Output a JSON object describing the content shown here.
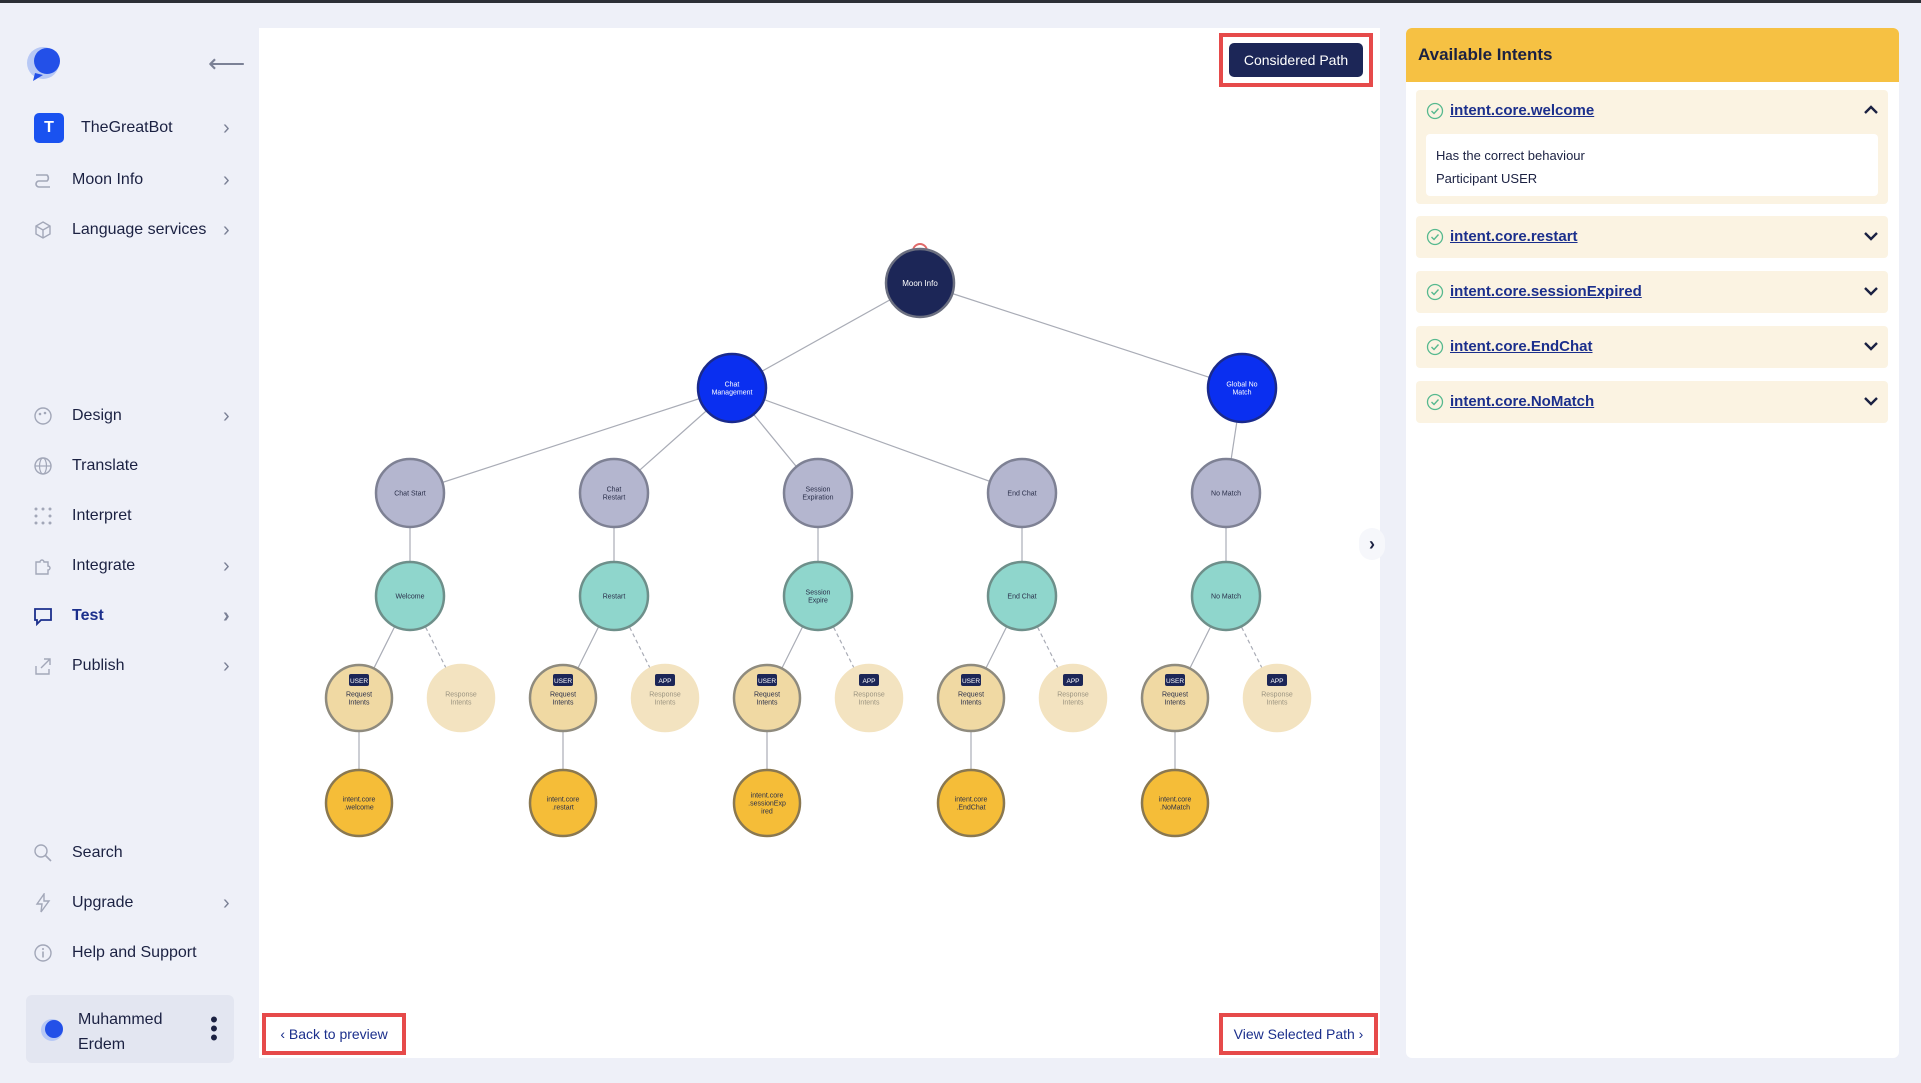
{
  "sidebar": {
    "bot": {
      "initial": "T",
      "name": "TheGreatBot"
    },
    "items_top": [
      {
        "label": "Moon Info",
        "icon": "route-icon",
        "chevron": true
      },
      {
        "label": "Language services",
        "icon": "cube-icon",
        "chevron": true
      }
    ],
    "items_mid": [
      {
        "label": "Design",
        "icon": "palette-icon",
        "chevron": true
      },
      {
        "label": "Translate",
        "icon": "globe-icon",
        "chevron": false
      },
      {
        "label": "Interpret",
        "icon": "dots-grid-icon",
        "chevron": false
      },
      {
        "label": "Integrate",
        "icon": "puzzle-icon",
        "chevron": true
      },
      {
        "label": "Test",
        "icon": "chat-bubble-icon",
        "chevron": true,
        "active": true
      },
      {
        "label": "Publish",
        "icon": "share-icon",
        "chevron": true
      }
    ],
    "items_bottom": [
      {
        "label": "Search",
        "icon": "search-icon",
        "chevron": false
      },
      {
        "label": "Upgrade",
        "icon": "bolt-icon",
        "chevron": true
      },
      {
        "label": "Help and Support",
        "icon": "info-icon",
        "chevron": false
      }
    ],
    "user": {
      "first": "Muhammed",
      "last": "Erdem"
    }
  },
  "canvas": {
    "considered_path_label": "Considered Path",
    "back_label": "‹ Back to preview",
    "view_label": "View Selected Path ›",
    "expand_label": "›"
  },
  "tree": {
    "root": "Moon Info",
    "level1": [
      "Chat Management",
      "Global No Match"
    ],
    "level2": [
      "Chat Start",
      "Chat Restart",
      "Session Expiration",
      "End Chat",
      "No Match"
    ],
    "level3": [
      "Welcome",
      "Restart",
      "Session Expire",
      "End Chat",
      "No Match"
    ],
    "request_label": "Request Intents",
    "response_label": "Response Intents",
    "user_tag": "USER",
    "app_tag": "APP",
    "level5": [
      "intent.core.welcome",
      "intent.core.restart",
      "intent.core.sessionExpired",
      "intent.core.EndChat",
      "intent.core.NoMatch"
    ],
    "colors": {
      "root": "#1c2657",
      "level1": "#0a2ff0",
      "level2": "#b4b6cf",
      "level3": "#8fd6cc",
      "request": "#f0d9a3",
      "response": "#f3e3c0",
      "intent": "#f5bd38"
    }
  },
  "panel": {
    "title": "Available Intents",
    "intents": [
      {
        "name": "intent.core.welcome",
        "expanded": true,
        "detail_1": "Has the correct behaviour",
        "detail_2": "Participant USER"
      },
      {
        "name": "intent.core.restart",
        "expanded": false
      },
      {
        "name": "intent.core.sessionExpired",
        "expanded": false
      },
      {
        "name": "intent.core.EndChat",
        "expanded": false
      },
      {
        "name": "intent.core.NoMatch",
        "expanded": false
      }
    ]
  }
}
